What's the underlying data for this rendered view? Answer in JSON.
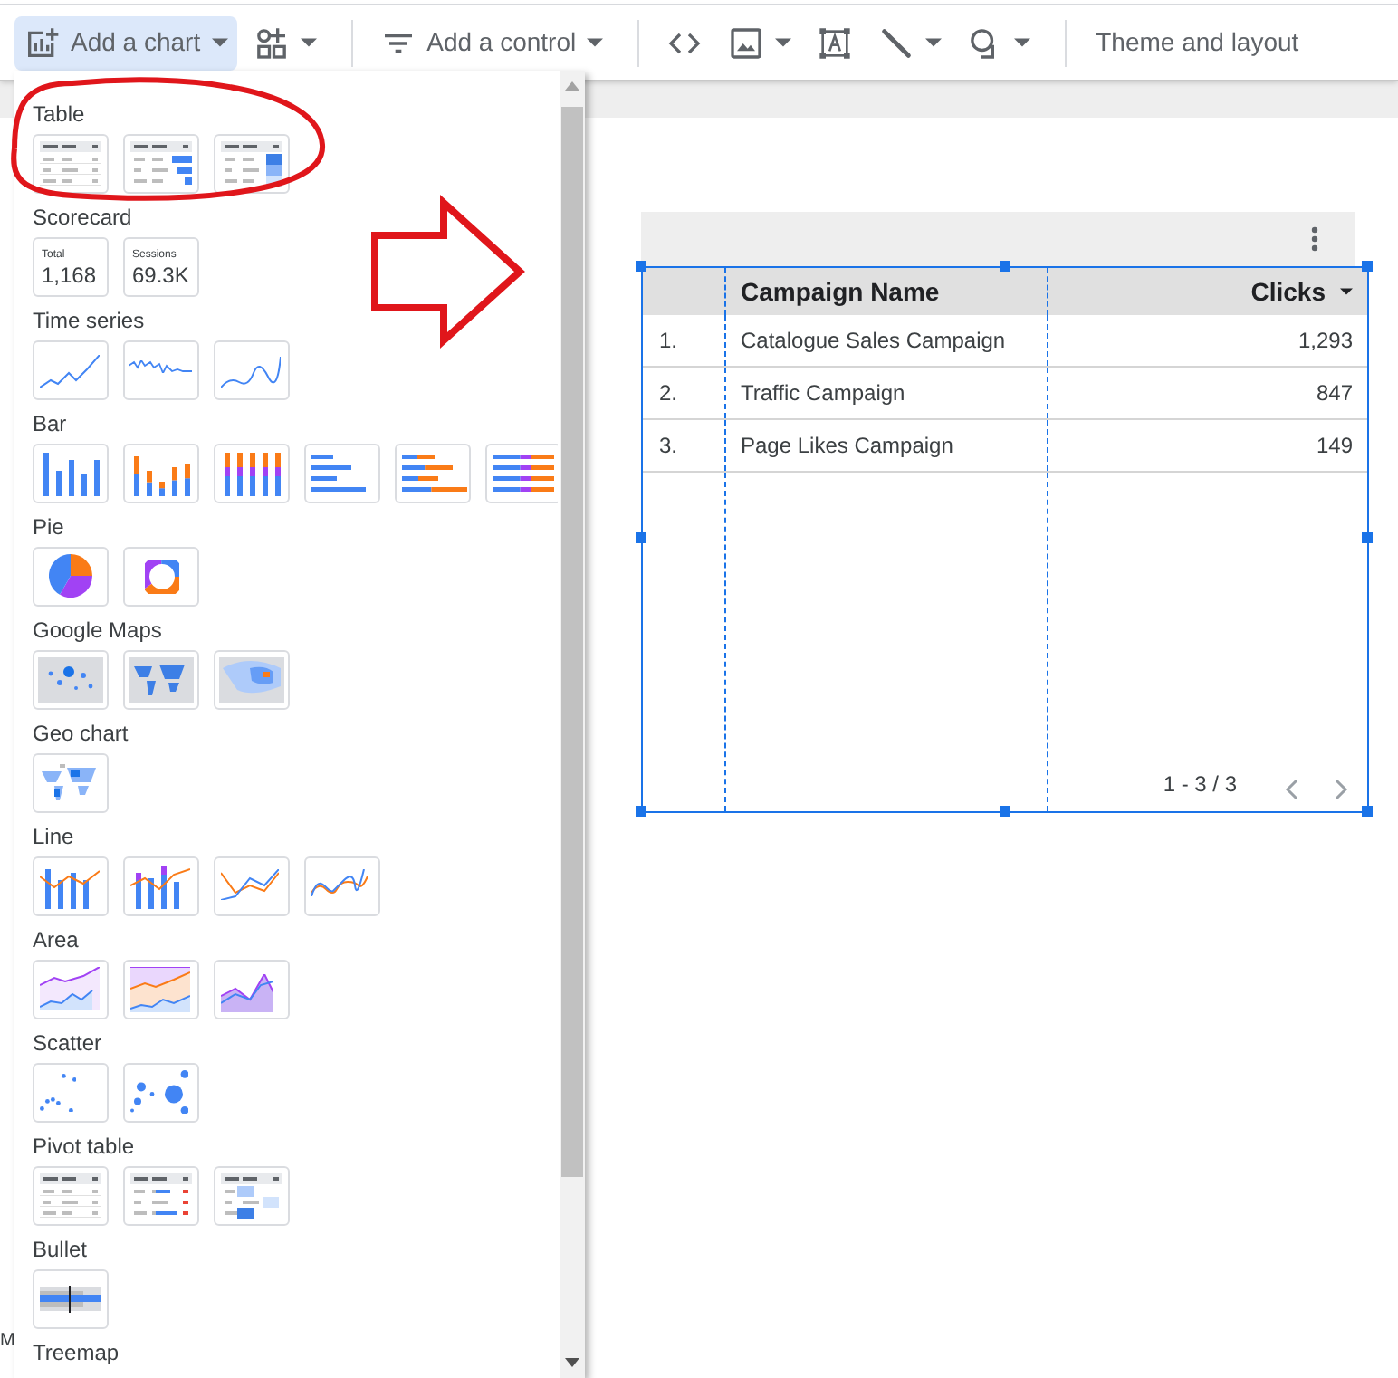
{
  "toolbar": [
    {
      "kind": "chart-menu",
      "label": "Add a chart",
      "open": true
    },
    {
      "kind": "component-menu"
    },
    {
      "kind": "divider"
    },
    {
      "kind": "control-menu",
      "label": "Add a control"
    },
    {
      "kind": "divider"
    },
    {
      "kind": "embed"
    },
    {
      "kind": "image-menu"
    },
    {
      "kind": "text"
    },
    {
      "kind": "line-menu"
    },
    {
      "kind": "shape-menu"
    },
    {
      "kind": "divider"
    },
    {
      "kind": "theme",
      "label": "Theme and layout"
    }
  ],
  "chart_menu": {
    "sections": [
      {
        "label": "Table",
        "options": [
          {
            "kind": "table"
          },
          {
            "kind": "table-bars"
          },
          {
            "kind": "table-heatmap"
          }
        ]
      },
      {
        "label": "Scorecard",
        "options": [
          {
            "kind": "scorecard",
            "caption": "Total",
            "value": "1,168"
          },
          {
            "kind": "scorecard",
            "caption": "Sessions",
            "value": "69.3K"
          }
        ]
      },
      {
        "label": "Time series",
        "options": [
          {
            "kind": "time-series"
          },
          {
            "kind": "sparkline"
          },
          {
            "kind": "smoothed-line"
          }
        ]
      },
      {
        "label": "Bar",
        "options": [
          {
            "kind": "column"
          },
          {
            "kind": "stacked-column"
          },
          {
            "kind": "percent-column"
          },
          {
            "kind": "bar"
          },
          {
            "kind": "stacked-bar"
          },
          {
            "kind": "percent-bar"
          }
        ]
      },
      {
        "label": "Pie",
        "options": [
          {
            "kind": "pie"
          },
          {
            "kind": "donut"
          }
        ]
      },
      {
        "label": "Google Maps",
        "options": [
          {
            "kind": "bubble-map"
          },
          {
            "kind": "filled-map"
          },
          {
            "kind": "heatmap"
          }
        ]
      },
      {
        "label": "Geo chart",
        "options": [
          {
            "kind": "geo"
          }
        ]
      },
      {
        "label": "Line",
        "options": [
          {
            "kind": "combo"
          },
          {
            "kind": "stacked-combo"
          },
          {
            "kind": "line"
          },
          {
            "kind": "smooth-line"
          }
        ]
      },
      {
        "label": "Area",
        "options": [
          {
            "kind": "area"
          },
          {
            "kind": "percent-area"
          },
          {
            "kind": "stacked-area"
          }
        ]
      },
      {
        "label": "Scatter",
        "options": [
          {
            "kind": "scatter"
          },
          {
            "kind": "bubble"
          }
        ]
      },
      {
        "label": "Pivot table",
        "options": [
          {
            "kind": "pivot"
          },
          {
            "kind": "pivot-bars"
          },
          {
            "kind": "pivot-heatmap"
          }
        ]
      },
      {
        "label": "Bullet",
        "options": [
          {
            "kind": "bullet"
          }
        ]
      },
      {
        "label": "Treemap"
      }
    ]
  },
  "canvas_fragment": "M",
  "table": {
    "columns": [
      {
        "label": "Campaign Name",
        "sorted": false
      },
      {
        "label": "Clicks",
        "sorted": true
      }
    ],
    "rows": [
      {
        "index": "1.",
        "cells": [
          "Catalogue Sales Campaign",
          "1,293"
        ]
      },
      {
        "index": "2.",
        "cells": [
          "Traffic Campaign",
          "847"
        ]
      },
      {
        "index": "3.",
        "cells": [
          "Page Likes Campaign",
          "149"
        ]
      }
    ],
    "pagination": "1 - 3 / 3"
  }
}
